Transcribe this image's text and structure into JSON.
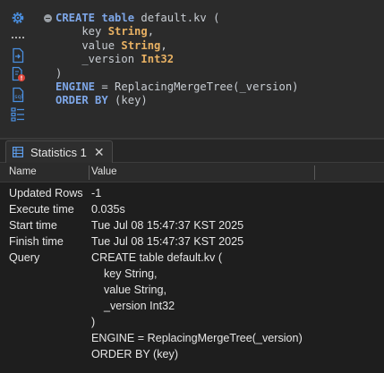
{
  "editor": {
    "sidebar_tools": [
      {
        "icon": "settings-gear-icon"
      },
      {
        "icon": "more-dots-icon"
      },
      {
        "icon": "export-file-icon"
      },
      {
        "icon": "error-file-icon"
      },
      {
        "icon": "script-file-icon"
      },
      {
        "icon": "outline-tree-icon"
      }
    ],
    "code_lines": [
      [
        {
          "t": "CREATE",
          "c": "kw"
        },
        {
          "t": " ",
          "c": ""
        },
        {
          "t": "table",
          "c": "kw"
        },
        {
          "t": " default.kv (",
          "c": ""
        }
      ],
      [
        {
          "t": "    key ",
          "c": ""
        },
        {
          "t": "String",
          "c": "ty"
        },
        {
          "t": ",",
          "c": ""
        }
      ],
      [
        {
          "t": "    value ",
          "c": ""
        },
        {
          "t": "String",
          "c": "ty"
        },
        {
          "t": ",",
          "c": ""
        }
      ],
      [
        {
          "t": "    _version ",
          "c": ""
        },
        {
          "t": "Int32",
          "c": "ty"
        }
      ],
      [
        {
          "t": ")",
          "c": ""
        }
      ],
      [
        {
          "t": "ENGINE",
          "c": "kw"
        },
        {
          "t": " = ReplacingMergeTree(_version)",
          "c": ""
        }
      ],
      [
        {
          "t": "ORDER",
          "c": "kw"
        },
        {
          "t": " ",
          "c": ""
        },
        {
          "t": "BY",
          "c": "kw"
        },
        {
          "t": " (key)",
          "c": ""
        }
      ]
    ]
  },
  "tab": {
    "label": "Statistics 1",
    "close": "✕"
  },
  "table": {
    "headers": {
      "name": "Name",
      "value": "Value"
    },
    "rows": [
      {
        "name": "Updated Rows",
        "value": [
          "-1"
        ]
      },
      {
        "name": "Execute time",
        "value": [
          "0.035s"
        ]
      },
      {
        "name": "Start time",
        "value": [
          "Tue Jul 08 15:47:37 KST 2025"
        ]
      },
      {
        "name": "Finish time",
        "value": [
          "Tue Jul 08 15:47:37 KST 2025"
        ]
      },
      {
        "name": "Query",
        "value": [
          "CREATE table default.kv (",
          "    key String,",
          "    value String,",
          "    _version Int32",
          ")",
          "ENGINE = ReplacingMergeTree(_version)",
          "ORDER BY (key)"
        ]
      }
    ]
  },
  "colors": {
    "editor_bg": "#2b2b2b",
    "keyword": "#7ea7e8",
    "type": "#e8b163",
    "text": "#c8cdd3",
    "results_bg": "#1e1e1e"
  }
}
